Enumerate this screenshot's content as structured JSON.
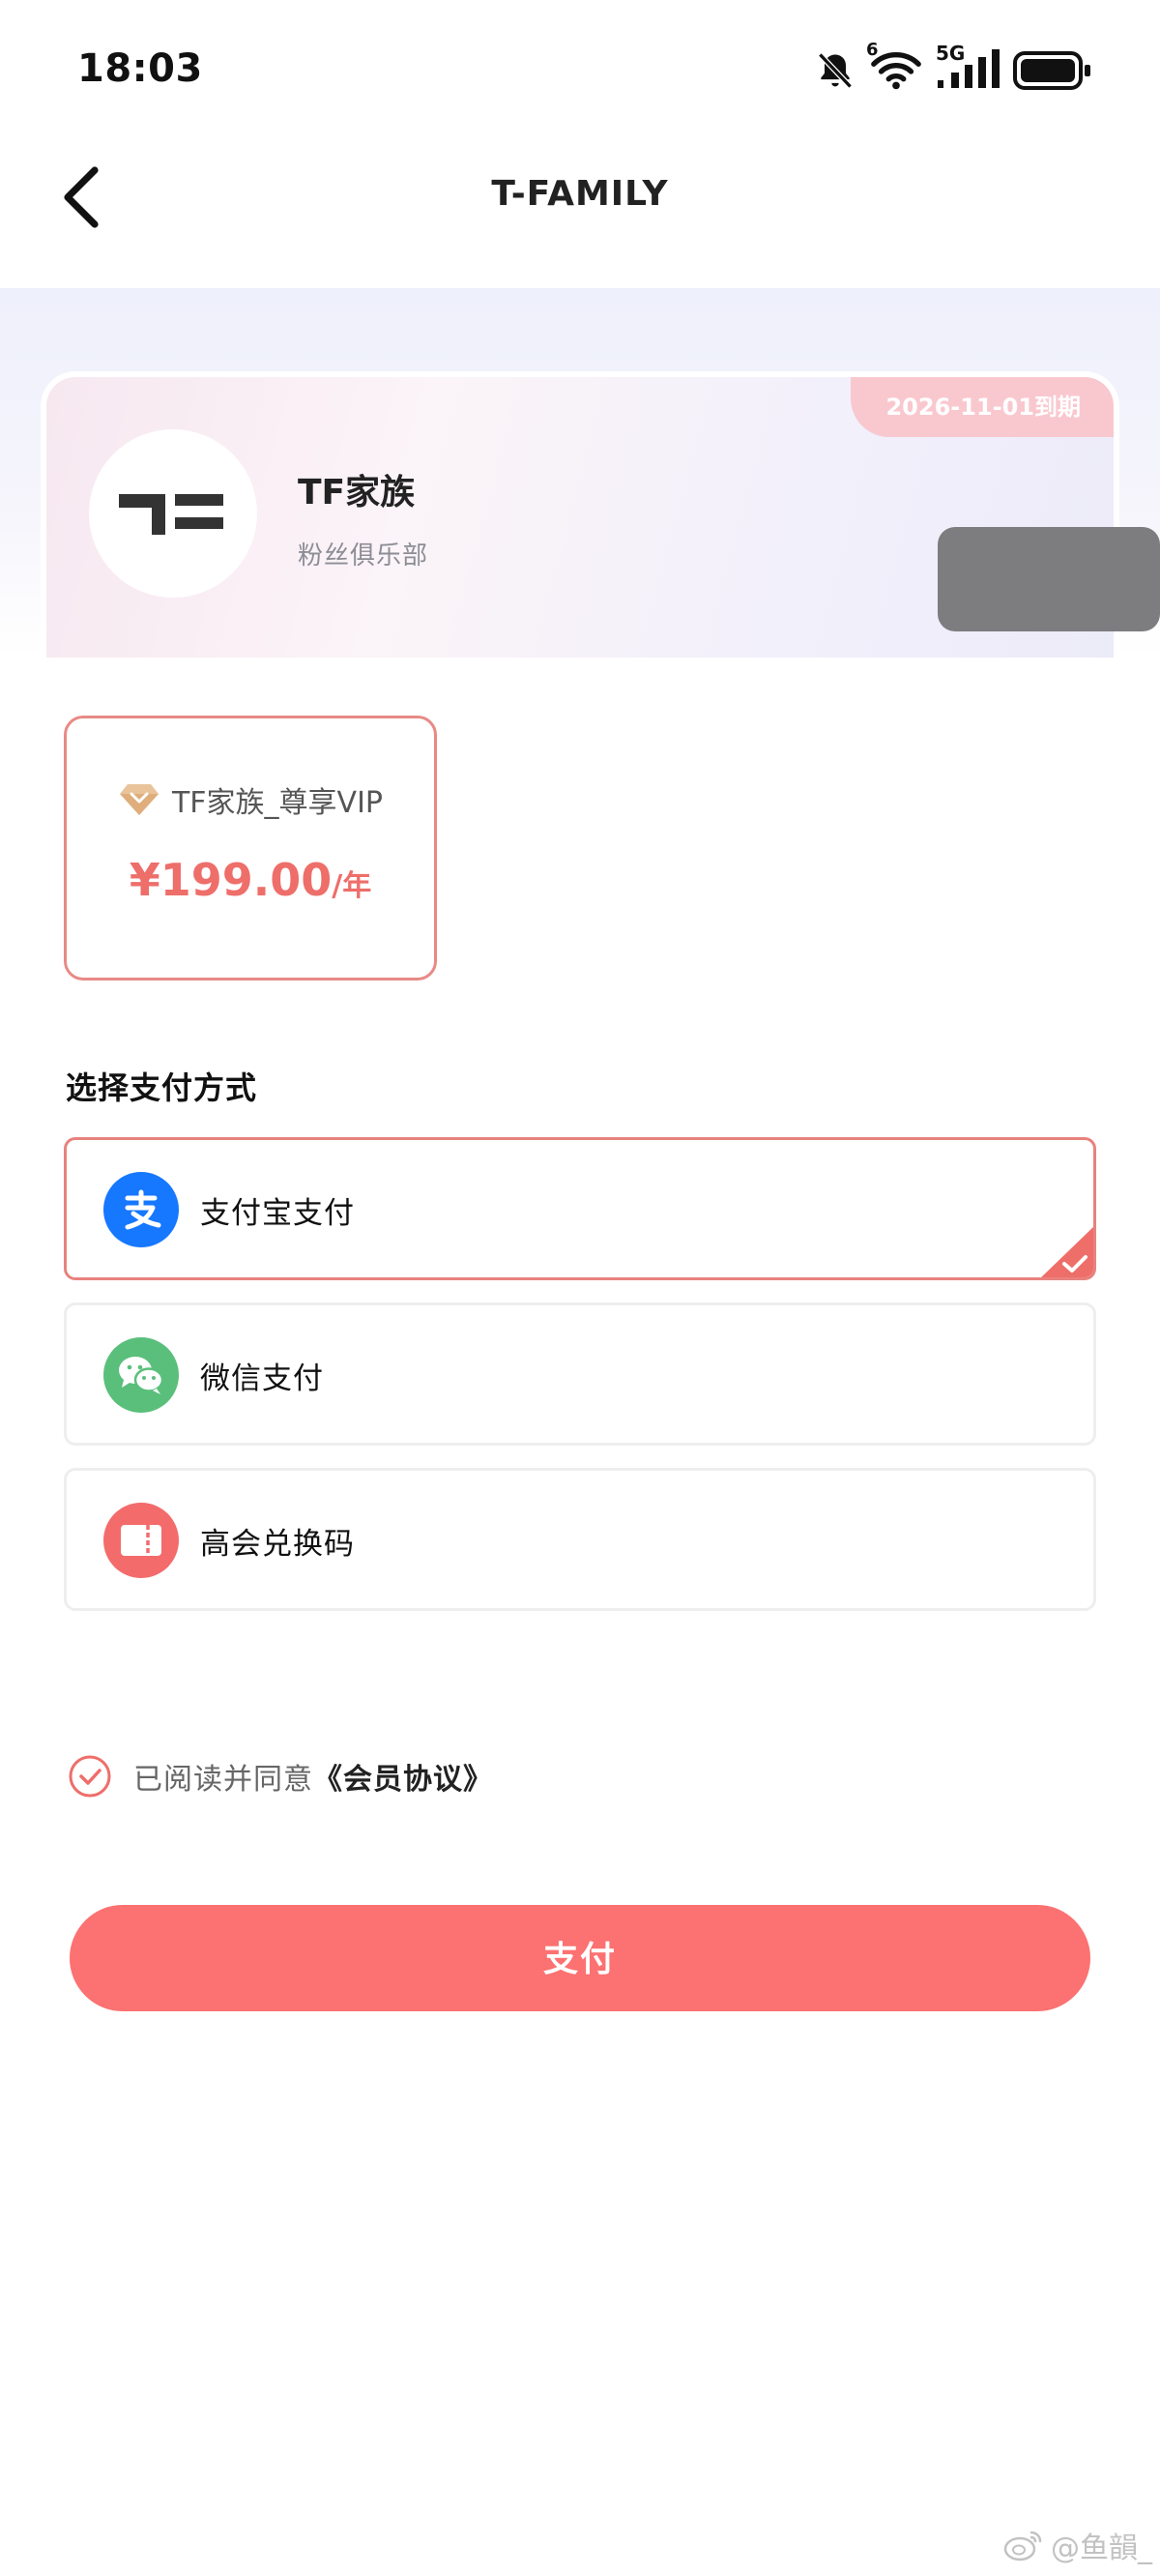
{
  "status_bar": {
    "time": "18:03",
    "wifi_badge": "6",
    "network": "5G",
    "icons": [
      "bell-muted-icon",
      "wifi-icon",
      "signal-icon",
      "battery-icon"
    ]
  },
  "nav": {
    "title": "T-FAMILY",
    "back_icon": "chevron-left-icon"
  },
  "club": {
    "name": "TF家族",
    "subtitle": "粉丝俱乐部",
    "expiry": "2026-11-01到期",
    "logo_icon": "tf-logo-icon"
  },
  "plan": {
    "icon": "diamond-icon",
    "name": "TF家族_尊享VIP",
    "price": "¥199.00",
    "unit": "/年"
  },
  "payment": {
    "section_title": "选择支付方式",
    "options": [
      {
        "label": "支付宝支付",
        "icon": "alipay-icon",
        "color": "#1677ff",
        "selected": true
      },
      {
        "label": "微信支付",
        "icon": "wechat-icon",
        "color": "#5bbf7c",
        "selected": false
      },
      {
        "label": "高会兑换码",
        "icon": "ticket-icon",
        "color": "#f36b6b",
        "selected": false
      }
    ]
  },
  "agreement": {
    "prefix": "已阅读并同意",
    "link": "《会员协议》"
  },
  "pay_button": {
    "label": "支付"
  },
  "watermark": {
    "text": "@鱼韻_"
  },
  "colors": {
    "accent": "#fc7171",
    "price": "#ee6e6a",
    "selected_border": "#e8827e",
    "badge": "#f9c8cf"
  }
}
